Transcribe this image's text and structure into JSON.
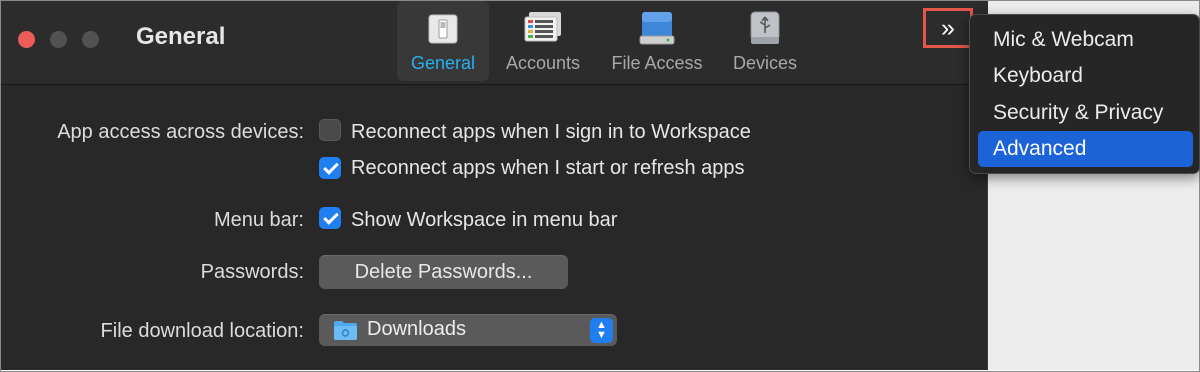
{
  "window": {
    "title": "General"
  },
  "toolbar": {
    "tabs": [
      {
        "label": "General",
        "icon": "switch-icon",
        "selected": true
      },
      {
        "label": "Accounts",
        "icon": "accounts-icon",
        "selected": false
      },
      {
        "label": "File Access",
        "icon": "disk-icon",
        "selected": false
      },
      {
        "label": "Devices",
        "icon": "usb-drive-icon",
        "selected": false
      }
    ],
    "overflow_label": "»"
  },
  "settings": {
    "app_access": {
      "label": "App access across devices:",
      "options": [
        {
          "label": "Reconnect apps when I sign in to Workspace",
          "checked": false
        },
        {
          "label": "Reconnect apps when I start or refresh apps",
          "checked": true
        }
      ]
    },
    "menu_bar": {
      "label": "Menu bar:",
      "option": {
        "label": "Show Workspace in menu bar",
        "checked": true
      }
    },
    "passwords": {
      "label": "Passwords:",
      "button_label": "Delete Passwords..."
    },
    "file_download": {
      "label": "File download location:",
      "value": "Downloads"
    }
  },
  "overflow_menu": {
    "items": [
      {
        "label": "Mic & Webcam",
        "active": false
      },
      {
        "label": "Keyboard",
        "active": false
      },
      {
        "label": "Security & Privacy",
        "active": false
      },
      {
        "label": "Advanced",
        "active": true
      }
    ]
  },
  "colors": {
    "accent": "#1f7ff0",
    "selected_tab_text": "#27b0ee",
    "highlight": "#e4554a",
    "menu_active": "#1b63d6"
  }
}
